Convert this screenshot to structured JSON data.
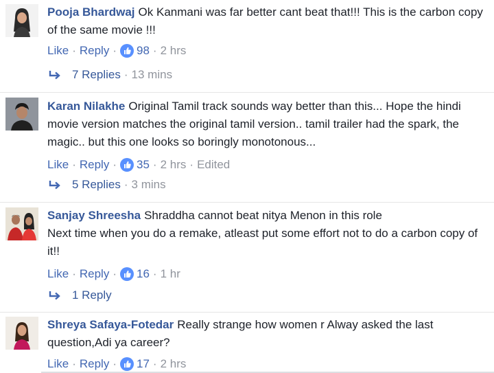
{
  "comments": [
    {
      "author": "Pooja Bhardwaj",
      "text": "Ok Kanmani was far better cant beat that!!! This is the carbon copy of the same movie !!!",
      "like_label": "Like",
      "reply_label": "Reply",
      "likes": "98",
      "time": "2 hrs",
      "edited": "",
      "replies": {
        "label": "7 Replies",
        "time": "13 mins"
      },
      "avatar_icon": "woman-profile-photo"
    },
    {
      "author": "Karan Nilakhe",
      "text": "Original Tamil track sounds way better than this... Hope the hindi movie version matches the original tamil version.. tamil trailer had the spark, the magic.. but this one looks so boringly monotonous...",
      "like_label": "Like",
      "reply_label": "Reply",
      "likes": "35",
      "time": "2 hrs",
      "edited": "Edited",
      "replies": {
        "label": "5 Replies",
        "time": "3 mins"
      },
      "avatar_icon": "man-profile-photo"
    },
    {
      "author": "Sanjay Shreesha",
      "text": "Shraddha cannot beat nitya Menon in this role\nNext time when you do a remake, atleast put some effort not to do a carbon copy of it!!",
      "like_label": "Like",
      "reply_label": "Reply",
      "likes": "16",
      "time": "1 hr",
      "edited": "",
      "replies": {
        "label": "1 Reply",
        "time": ""
      },
      "avatar_icon": "couple-profile-photo"
    },
    {
      "author": "Shreya Safaya-Fotedar",
      "text": "Really strange how women r Alway asked the last question,Adi ya career?",
      "like_label": "Like",
      "reply_label": "Reply",
      "likes": "17",
      "time": "2 hrs",
      "edited": "",
      "avatar_icon": "woman-profile-photo"
    }
  ],
  "separator": "·",
  "icons": {
    "like": "thumbs-up-icon",
    "reply_arrow": "reply-arrow-icon"
  },
  "colors": {
    "link": "#4267b2",
    "author": "#365899",
    "meta": "#90949c",
    "like_badge": "#5890ff"
  }
}
